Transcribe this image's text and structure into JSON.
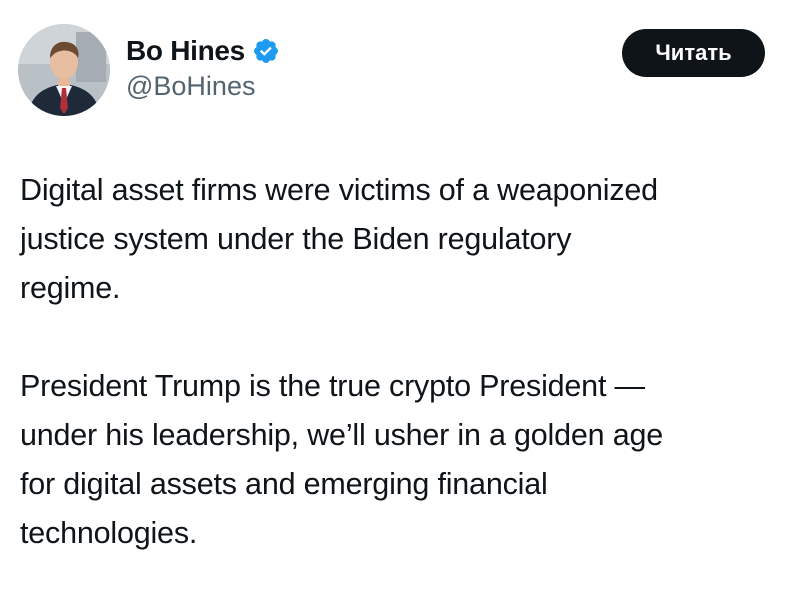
{
  "author": {
    "display_name": "Bo Hines",
    "handle": "@BoHines",
    "verified": true,
    "verified_icon": "verified-badge-icon",
    "avatar": "profile-photo"
  },
  "actions": {
    "read_label": "Читать"
  },
  "tweet": {
    "paragraphs": [
      "Digital asset firms were victims of a weaponized\njustice system under the Biden regulatory\nregime.",
      "President Trump is the true crypto President —\nunder his leadership, we’ll usher in a golden age\nfor digital assets and emerging financial\ntechnologies."
    ]
  },
  "colors": {
    "text": "#0f1419",
    "secondary_text": "#536471",
    "verified": "#1d9bf0",
    "button_bg": "#0f1419",
    "button_text": "#ffffff"
  }
}
